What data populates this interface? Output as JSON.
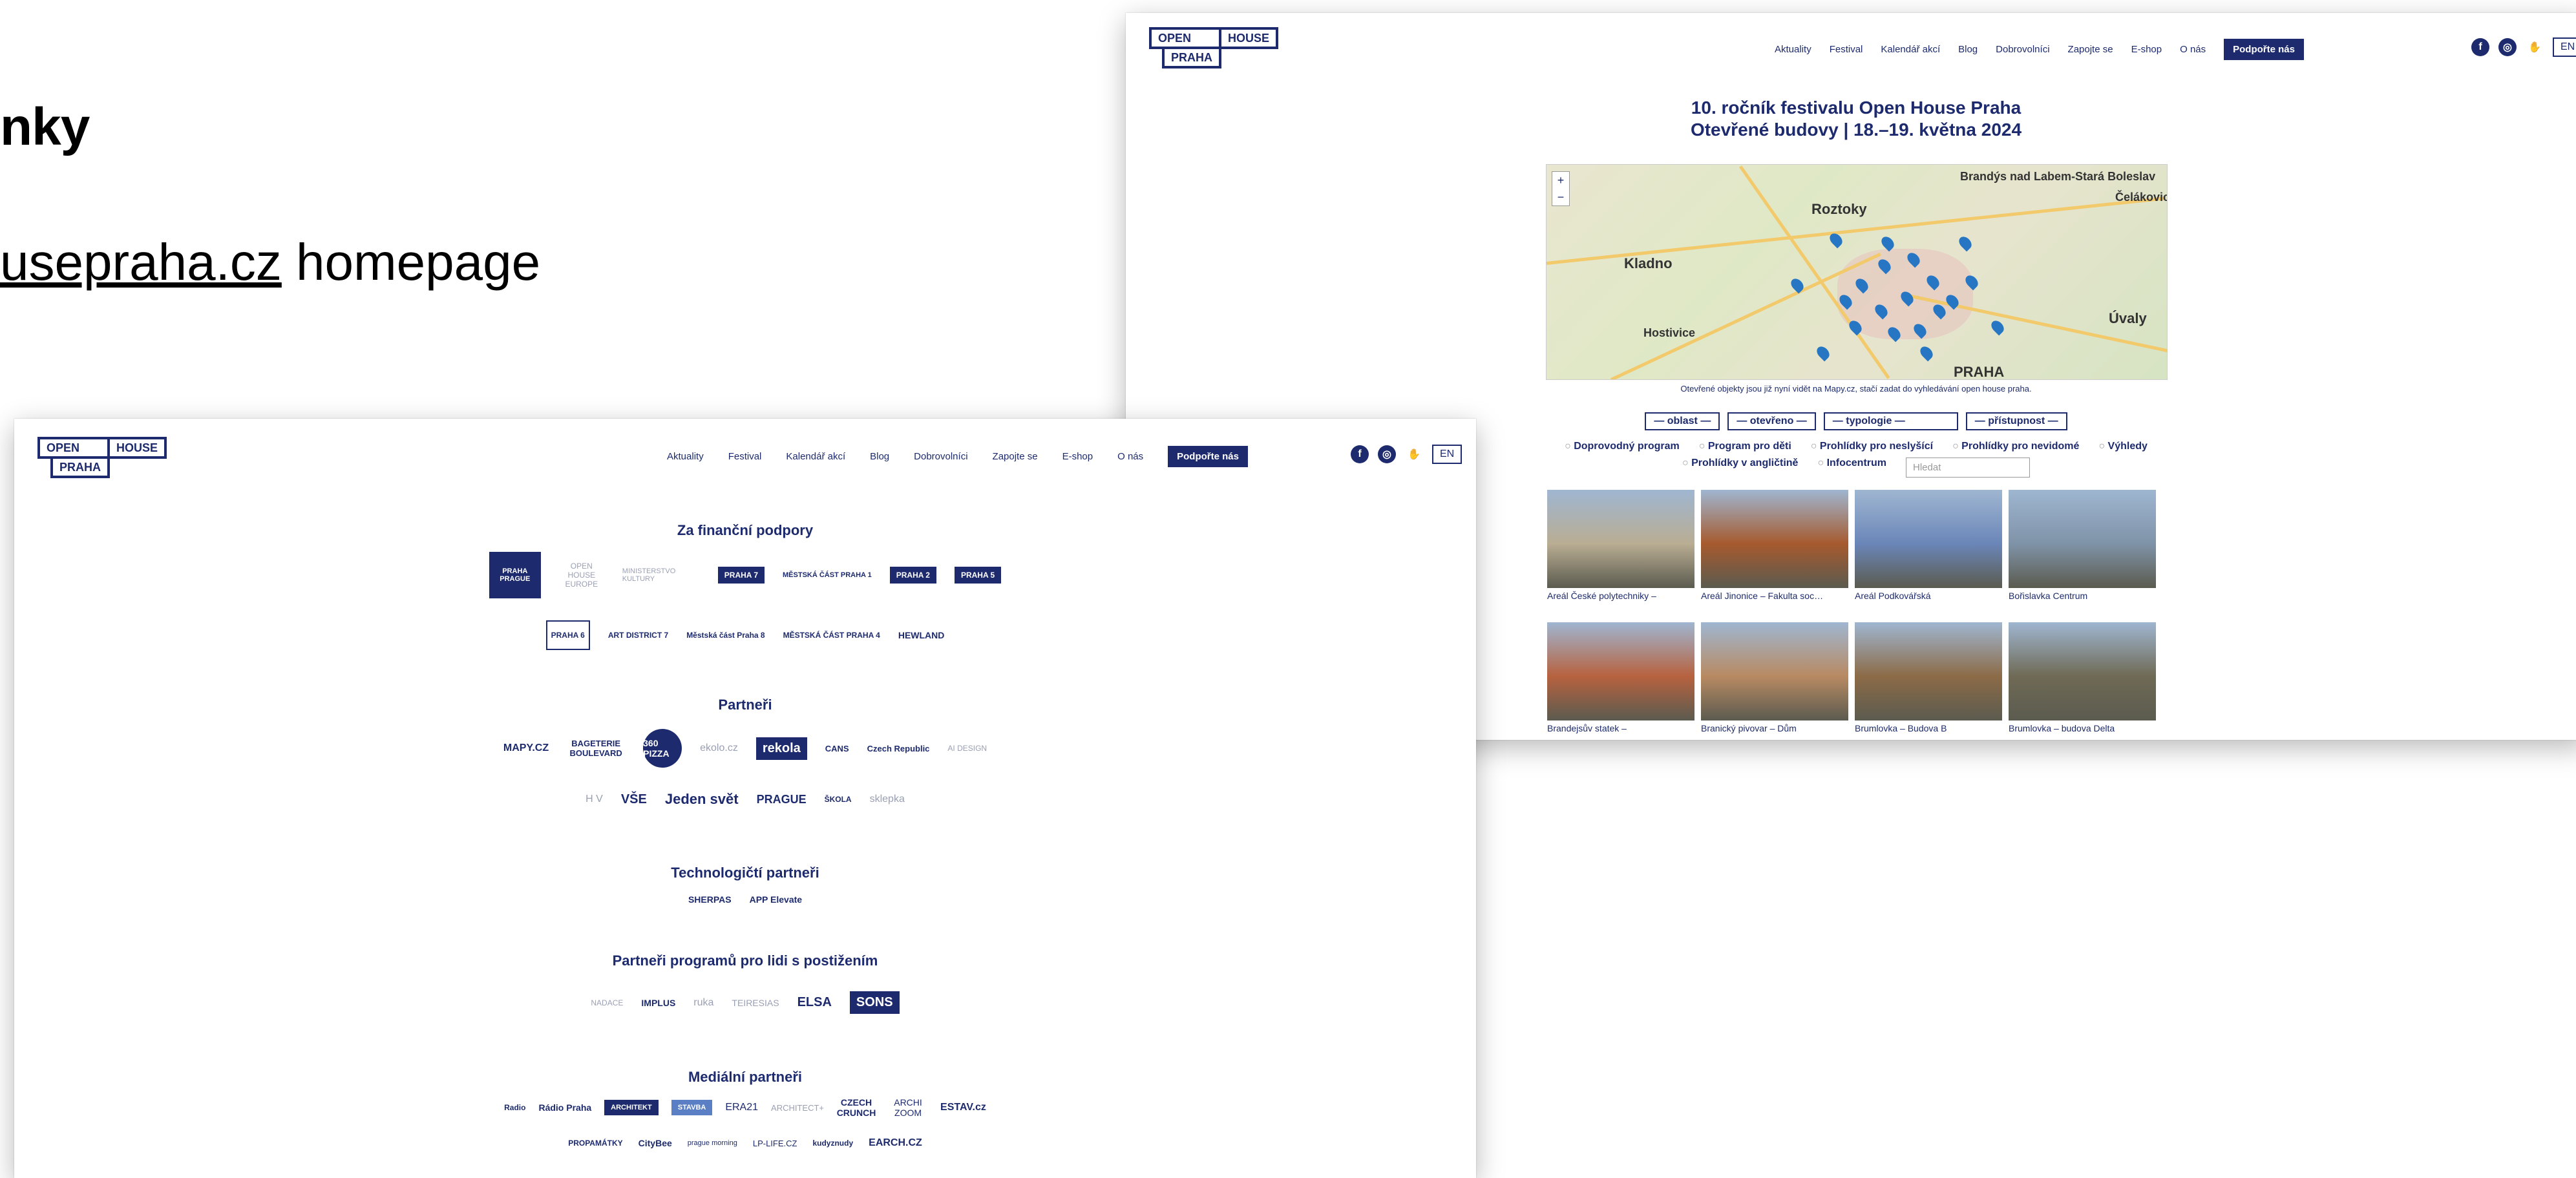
{
  "slide": {
    "title_fragment": "nky",
    "sub_link": "usepraha.cz",
    "sub_rest": " homepage"
  },
  "logo": {
    "open": "OPEN",
    "house": "HOUSE",
    "praha": "PRAHA"
  },
  "nav": {
    "items": [
      "Aktuality",
      "Festival",
      "Kalendář akcí",
      "Blog",
      "Dobrovolníci",
      "Zapojte se",
      "E-shop",
      "O nás"
    ],
    "support": "Podpořte nás",
    "lang": "EN"
  },
  "festival": {
    "line1": "10. ročník festivalu Open House Praha",
    "line2": "Otevřené budovy | 18.–19. května 2024"
  },
  "map": {
    "labels": [
      "Brandýs nad Labem-Stará Boleslav",
      "Roztoky",
      "Čelákovice",
      "Kladno",
      "Hostivice",
      "Úvaly",
      "PRAHA"
    ],
    "zoom_in": "+",
    "zoom_out": "−",
    "note": "Otevřené objekty jsou již nyní vidět na Mapy.cz, stačí zadat do vyhledávání open house praha."
  },
  "filters": {
    "selects": [
      "— oblast —",
      "— otevřeno —",
      "— typologie —",
      "— přístupnost —"
    ],
    "checkboxes": [
      "Doprovodný program",
      "Program pro děti",
      "Prohlídky pro neslyšící",
      "Prohlídky pro nevidomé",
      "Výhledy",
      "Prohlídky v angličtině",
      "Infocentrum"
    ],
    "search_placeholder": "Hledat"
  },
  "buildings": [
    {
      "title": "Areál České polytechniky –",
      "color": "#b9ad93"
    },
    {
      "title": "Areál Jinonice – Fakulta soc…",
      "color": "#a65a2e"
    },
    {
      "title": "Areál Podkovářská",
      "color": "#6a86b8"
    },
    {
      "title": "Bořislavka Centrum",
      "color": "#7f93a8"
    },
    {
      "title": "Brandejsův statek –",
      "color": "#b7623f"
    },
    {
      "title": "Branický pivovar – Dům",
      "color": "#b88a62"
    },
    {
      "title": "Brumlovka – Budova B",
      "color": "#8c6b47"
    },
    {
      "title": "Brumlovka – budova Delta",
      "color": "#6f6a55"
    }
  ],
  "sections": {
    "financial": "Za finanční podpory",
    "partners": "Partneři",
    "tech": "Technologičtí partneři",
    "disabled": "Partneři programů pro lidi s postižením",
    "media": "Mediální partneři"
  },
  "logos": {
    "financial_row1": [
      "PRAHA PRAGUE",
      "OPEN HOUSE EUROPE",
      "MINISTERSTVO KULTURY",
      "PRAHA 7",
      "MĚSTSKÁ ČÁST PRAHA 1",
      "PRAHA 2",
      "PRAHA 5"
    ],
    "financial_row2": [
      "PRAHA 6",
      "ART DISTRICT 7",
      "Městská část Praha 8",
      "MĚSTSKÁ ČÁST PRAHA 4",
      "HEWLAND"
    ],
    "partners_row1": [
      "MAPY.CZ",
      "BAGETERIE BOULEVARD",
      "360 PIZZA",
      "ekolo.cz",
      "rekola",
      "CANS",
      "Czech Republic",
      "AI DESIGN"
    ],
    "partners_row2": [
      "H V",
      "VŠE",
      "Jeden svět",
      "PRAGUE",
      "ŠKOLA",
      "sklepka"
    ],
    "tech": [
      "SHERPAS",
      "APP Elevate"
    ],
    "disabled": [
      "NADACE",
      "IMPLUS",
      "ruka",
      "TEIRESIAS",
      "ELSA",
      "SONS"
    ],
    "media_row1": [
      "Radio",
      "Rádio Praha",
      "ARCHITEKT",
      "STAVBA",
      "ERA21",
      "ARCHITECT+",
      "CZECH CRUNCH",
      "ARCHI ZOOM",
      "ESTAV.cz"
    ],
    "media_row2": [
      "PROPAMÁTKY",
      "CityBee",
      "prague morning",
      "LP-LIFE.CZ",
      "kudyznudy",
      "EARCH.CZ"
    ]
  },
  "colors": {
    "brand": "#1d2b6e",
    "map_pin": "#2676c4"
  }
}
